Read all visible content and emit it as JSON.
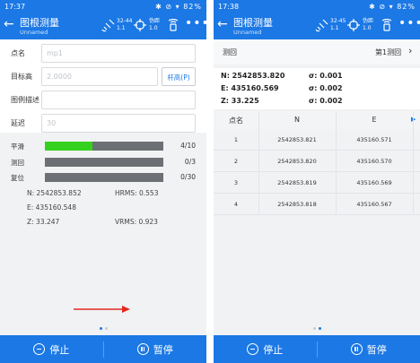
{
  "screens": [
    {
      "status": {
        "time": "17:37",
        "right": "82%"
      },
      "appbar": {
        "title": "图根测量",
        "subtitle": "Unnamed",
        "sat_top": "32-44",
        "sat_bottom": "1.1",
        "fix_top": "伪距",
        "fix_bottom": "1.0"
      },
      "form": {
        "point_label": "点名",
        "point_placeholder": "mp1",
        "height_label": "目标高",
        "height_placeholder": "2.0000",
        "pole_button": "杆高(P)",
        "code_label": "图例描述",
        "code_placeholder": "",
        "delay_label": "延迟",
        "delay_placeholder": "30"
      },
      "progress": [
        {
          "label": "平滑",
          "count": "4/10",
          "fraction": 0.4
        },
        {
          "label": "测回",
          "count": "0/3",
          "fraction": 0
        },
        {
          "label": "复位",
          "count": "0/30",
          "fraction": 0
        }
      ],
      "result": {
        "n": "N:  2542853.852",
        "hrms": "HRMS:  0.553",
        "e": "E:  435160.548",
        "z": "Z:  33.247",
        "vrms": "VRMS:  0.923"
      },
      "bottom": {
        "stop": "停止",
        "pause": "暂停"
      }
    },
    {
      "status": {
        "time": "17:38",
        "right": "82%"
      },
      "appbar": {
        "title": "图根测量",
        "subtitle": "Unnamed",
        "sat_top": "32-45",
        "sat_bottom": "1.1",
        "fix_top": "伪距",
        "fix_bottom": "1.0"
      },
      "round": {
        "label": "测回",
        "value": "第1测回"
      },
      "summary": {
        "n": "N:  2542853.820",
        "n_sigma": "σ:  0.001",
        "e": "E:  435160.569",
        "e_sigma": "σ:  0.002",
        "z": "Z:  33.225",
        "z_sigma": "σ:  0.002"
      },
      "table": {
        "headers": [
          "点名",
          "N",
          "E"
        ],
        "rows": [
          [
            "1",
            "2542853.821",
            "435160.571"
          ],
          [
            "2",
            "2542853.820",
            "435160.570"
          ],
          [
            "3",
            "2542853.819",
            "435160.569"
          ],
          [
            "4",
            "2542853.818",
            "435160.567"
          ]
        ]
      },
      "bottom": {
        "stop": "停止",
        "pause": "暂停"
      }
    }
  ],
  "colors": {
    "accent": "#1b78e5",
    "progress_fill": "#35d11f",
    "progress_track": "#6c6f73",
    "arrow": "#e3291f"
  }
}
